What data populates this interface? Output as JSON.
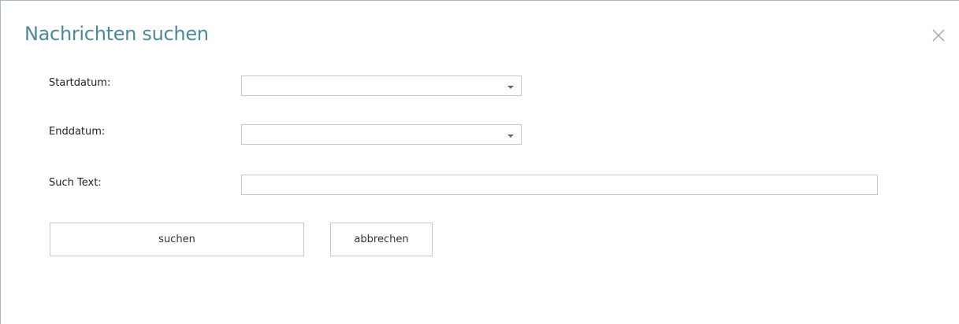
{
  "dialog": {
    "title": "Nachrichten suchen",
    "close_icon": "close-icon"
  },
  "form": {
    "start_date": {
      "label": "Startdatum:",
      "value": "",
      "icon": "chevron-down-icon"
    },
    "end_date": {
      "label": "Enddatum:",
      "value": "",
      "icon": "chevron-down-icon"
    },
    "search_text": {
      "label": "Such Text:",
      "value": "",
      "placeholder": ""
    }
  },
  "buttons": {
    "search_label": "suchen",
    "cancel_label": "abbrechen"
  },
  "colors": {
    "title": "#4a8a97",
    "border": "#c8c8c8",
    "window_border": "#a9b6c9"
  }
}
